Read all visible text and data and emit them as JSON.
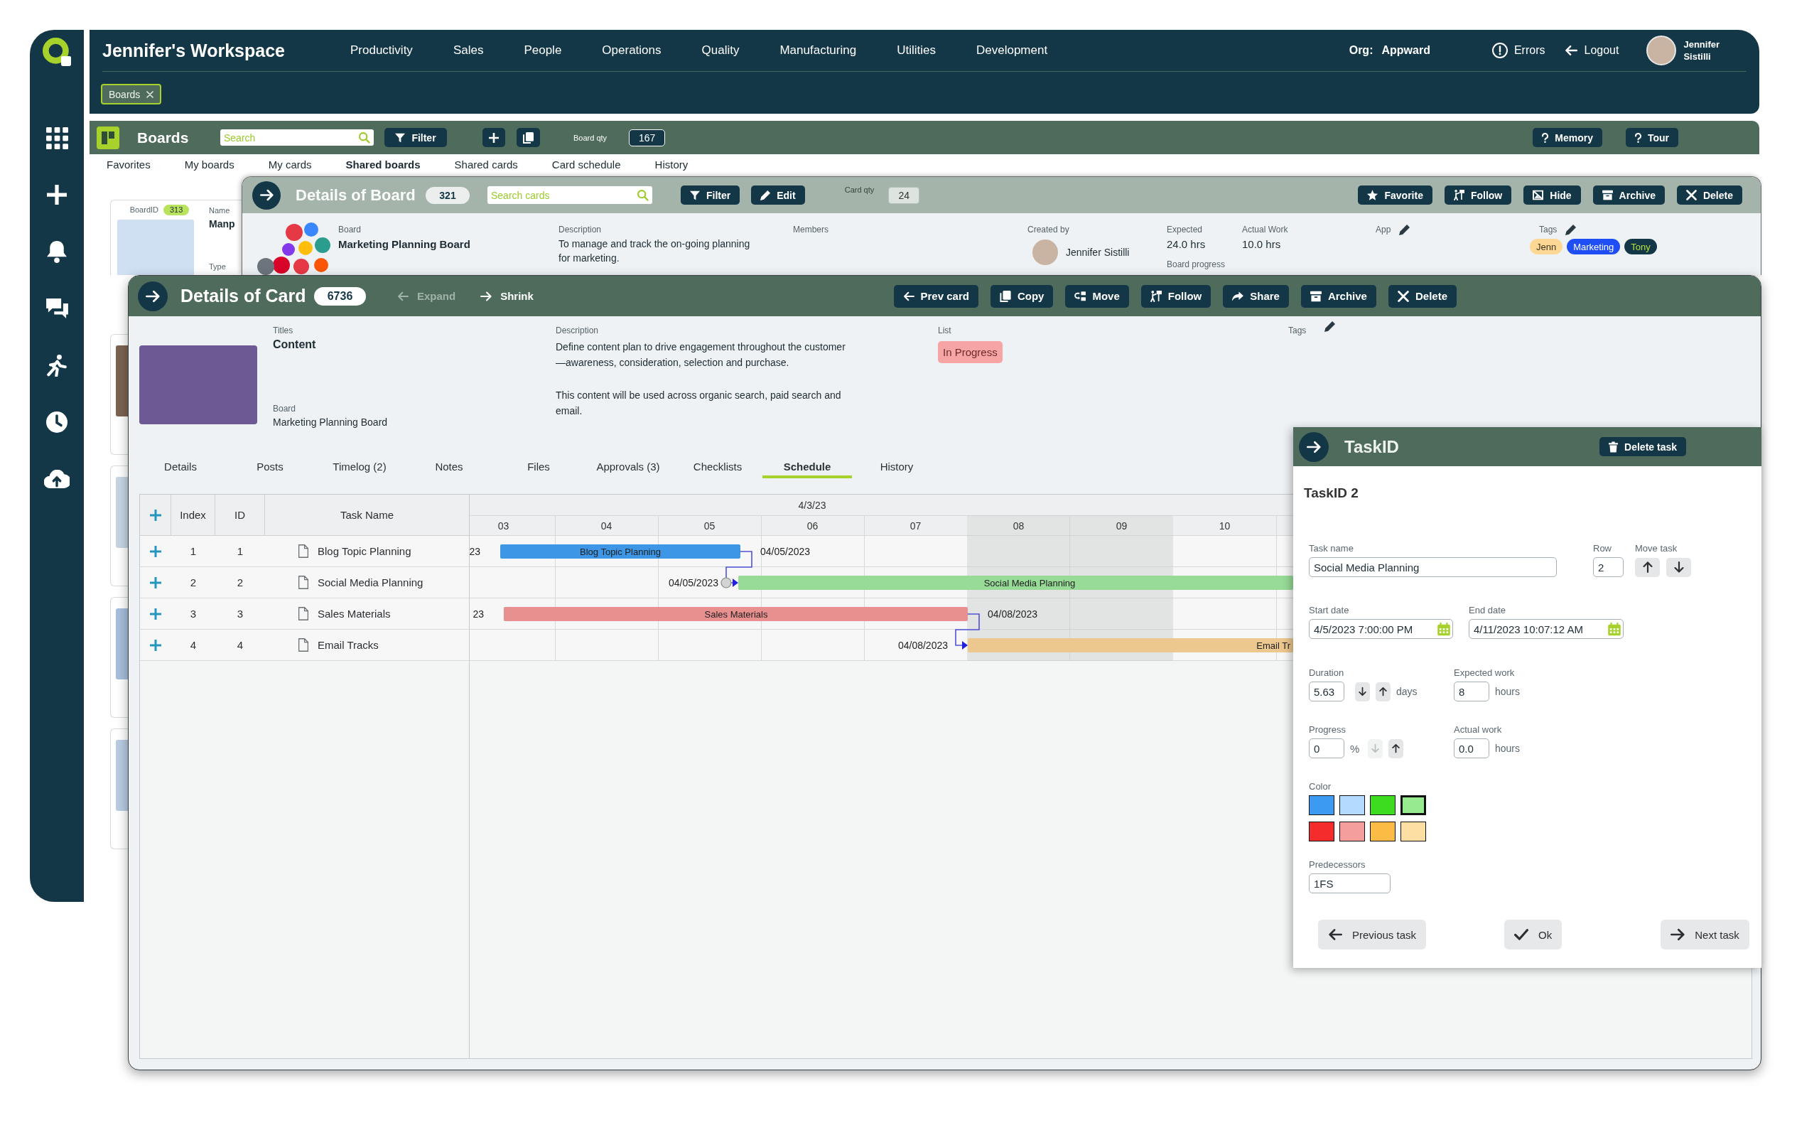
{
  "header": {
    "title": "Jennifer's Workspace",
    "menu": [
      "Productivity",
      "Sales",
      "People",
      "Operations",
      "Quality",
      "Manufacturing",
      "Utilities",
      "Development"
    ],
    "org_label": "Org:",
    "org": "Appward",
    "errors": "Errors",
    "logout": "Logout",
    "user": "Jennifer Sistilli",
    "open_tabs": [
      {
        "label": "Boards",
        "selected": true
      }
    ]
  },
  "boards": {
    "title": "Boards",
    "search": {
      "placeholder": "Search"
    },
    "filter": "Filter",
    "qty_label": "Board qty",
    "qty": "167",
    "help_buttons": [
      "Memory",
      "Tour"
    ],
    "tabs": [
      {
        "label": "Favorites",
        "selected": false
      },
      {
        "label": "My boards",
        "selected": false
      },
      {
        "label": "My cards",
        "selected": false
      },
      {
        "label": "Shared boards",
        "selected": true
      },
      {
        "label": "Shared cards",
        "selected": false
      },
      {
        "label": "Card schedule",
        "selected": false
      },
      {
        "label": "History",
        "selected": false
      }
    ],
    "card": {
      "id_label": "BoardID",
      "id": "313",
      "name_label": "Name",
      "name": "Manp",
      "type_label": "Type"
    }
  },
  "board_details": {
    "title": "Details of Board",
    "count": "321",
    "search": {
      "placeholder": "Search cards"
    },
    "tools": [
      {
        "kind": "filter",
        "label": "Filter"
      },
      {
        "kind": "edit",
        "label": "Edit"
      }
    ],
    "qty_label": "Card qty",
    "qty": "24",
    "actions": [
      {
        "kind": "favorite",
        "label": "Favorite"
      },
      {
        "kind": "follow",
        "label": "Follow"
      },
      {
        "kind": "hide",
        "label": "Hide"
      },
      {
        "kind": "archive",
        "label": "Archive"
      },
      {
        "kind": "delete",
        "label": "Delete"
      }
    ],
    "board_label": "Board",
    "board": "Marketing Planning Board",
    "description_label": "Description",
    "description": "To manage and track the on-going planning for marketing.",
    "members_label": "Members",
    "created_by_label": "Created by",
    "created_by": "Jennifer Sistilli",
    "expected_label": "Expected",
    "expected": "24.0 hrs",
    "actual_label": "Actual Work",
    "actual": "10.0 hrs",
    "progress_label": "Board progress",
    "app_label": "App",
    "tags_label": "Tags",
    "tags": [
      {
        "label": "Jenn",
        "color": "#fdd894"
      },
      {
        "label": "Marketing",
        "color": "#1f4ef5"
      },
      {
        "label": "Tony",
        "color": "#133747"
      }
    ]
  },
  "card_details": {
    "title": "Details of Card",
    "count": "6736",
    "nav": [
      {
        "kind": "expand",
        "label": "Expand",
        "disabled": true
      },
      {
        "kind": "shrink",
        "label": "Shrink",
        "disabled": false
      }
    ],
    "actions": [
      {
        "kind": "prev",
        "label": "Prev card"
      },
      {
        "kind": "copy",
        "label": "Copy"
      },
      {
        "kind": "move",
        "label": "Move"
      },
      {
        "kind": "follow",
        "label": "Follow"
      },
      {
        "kind": "share",
        "label": "Share"
      },
      {
        "kind": "archive",
        "label": "Archive"
      },
      {
        "kind": "delete",
        "label": "Delete"
      }
    ],
    "titles_label": "Titles",
    "title_value": "Content",
    "board_label": "Board",
    "board": "Marketing Planning Board",
    "description_label": "Description",
    "description": [
      "Define content plan to drive engagement throughout the customer—awareness, consideration, selection and purchase.",
      "This content will be used across organic search, paid search and email."
    ],
    "list_label": "List",
    "list": "In Progress",
    "tags_label": "Tags",
    "tabs": [
      {
        "label": "Details",
        "selected": false
      },
      {
        "label": "Posts",
        "selected": false
      },
      {
        "label": "Timelog (2)",
        "selected": false
      },
      {
        "label": "Notes",
        "selected": false
      },
      {
        "label": "Files",
        "selected": false
      },
      {
        "label": "Approvals (3)",
        "selected": false
      },
      {
        "label": "Checklists",
        "selected": false
      },
      {
        "label": "Schedule",
        "selected": true
      },
      {
        "label": "History",
        "selected": false
      }
    ],
    "schedule": {
      "columns": [
        "Index",
        "ID",
        "Task Name"
      ],
      "date": "4/3/23",
      "days": [
        {
          "label": "03",
          "weekend": false
        },
        {
          "label": "04",
          "weekend": false
        },
        {
          "label": "05",
          "weekend": false
        },
        {
          "label": "06",
          "weekend": false
        },
        {
          "label": "07",
          "weekend": false
        },
        {
          "label": "08",
          "weekend": true
        },
        {
          "label": "09",
          "weekend": true
        },
        {
          "label": "10",
          "weekend": false
        }
      ],
      "tasks": [
        {
          "index": "1",
          "id": "1",
          "name": "Blog Topic Planning",
          "bar_label": "Blog Topic Planning",
          "start_label": "23",
          "end_label": "04/05/2023",
          "color": "#3d97e6",
          "has_predecessor": false,
          "selected": false
        },
        {
          "index": "2",
          "id": "2",
          "name": "Social Media Planning",
          "bar_label": "Social Media Planning",
          "start_label": "04/05/2023",
          "color": "#97db97",
          "has_predecessor": true,
          "selected": true
        },
        {
          "index": "3",
          "id": "3",
          "name": "Sales Materials",
          "bar_label": "Sales Materials",
          "start_label": "23",
          "end_label": "04/08/2023",
          "color": "#e88f8f",
          "has_predecessor": false,
          "selected": false
        },
        {
          "index": "4",
          "id": "4",
          "name": "Email Tracks",
          "bar_label": "Email Tr",
          "start_label": "04/08/2023",
          "color": "#ecc78e",
          "has_predecessor": true,
          "selected": false
        }
      ]
    }
  },
  "task_panel": {
    "title": "TaskID",
    "delete_button": "Delete task",
    "heading": "TaskID 2",
    "task_name": {
      "label": "Task name",
      "value": "Social Media Planning"
    },
    "row": {
      "label": "Row",
      "value": "2"
    },
    "move_task": {
      "label": "Move task"
    },
    "start_date": {
      "label": "Start date",
      "value": "4/5/2023 7:00:00 PM"
    },
    "end_date": {
      "label": "End date",
      "value": "4/11/2023 10:07:12 AM"
    },
    "duration": {
      "label": "Duration",
      "value": "5.63",
      "unit": "days",
      "steppers": [
        {
          "kind": "down",
          "disabled": false
        },
        {
          "kind": "up",
          "disabled": false
        }
      ]
    },
    "expected_work": {
      "label": "Expected work",
      "value": "8",
      "unit": "hours"
    },
    "progress": {
      "label": "Progress",
      "value": "0",
      "unit": "%",
      "steppers": [
        {
          "kind": "down",
          "disabled": true
        },
        {
          "kind": "up",
          "disabled": false
        }
      ]
    },
    "actual_work": {
      "label": "Actual work",
      "value": "0.0",
      "unit": "hours"
    },
    "color": {
      "label": "Color",
      "swatches": [
        {
          "color": "#3d9af2",
          "selected": false
        },
        {
          "color": "#b5daff",
          "selected": false
        },
        {
          "color": "#3ddc1f",
          "selected": false
        },
        {
          "color": "#98ea8e",
          "selected": true
        },
        {
          "color": "#f42c2c",
          "selected": false
        },
        {
          "color": "#f59e9e",
          "selected": false
        },
        {
          "color": "#fbbb44",
          "selected": false
        },
        {
          "color": "#fddea3",
          "selected": false
        }
      ]
    },
    "predecessors": {
      "label": "Predecessors",
      "value": "1FS"
    },
    "buttons": [
      {
        "kind": "previous",
        "label": "Previous task"
      },
      {
        "kind": "ok",
        "label": "Ok"
      },
      {
        "kind": "next",
        "label": "Next task"
      }
    ]
  }
}
